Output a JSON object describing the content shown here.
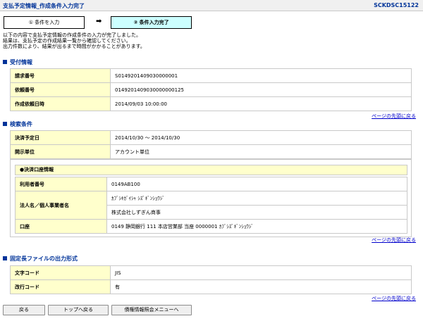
{
  "header": {
    "title": "支払予定情報_作成条件入力完了",
    "screen_id": "SCKDSC15122"
  },
  "steps": {
    "step1": "① 条件を入力",
    "arrow": "➡",
    "step2": "② 条件入力完了"
  },
  "intro": [
    "以下の内容で支払予定情報の作成条件の入力が完了しました。",
    "結果は、支払予定の作成結果一覧から確認してください。",
    "出力件数により、結果が出るまで時間がかかることがあります。"
  ],
  "reception": {
    "heading": "受付情報",
    "rows": [
      {
        "label": "請求番号",
        "value": "S0149201409030000001"
      },
      {
        "label": "依頼番号",
        "value": "0149201409030000000125"
      },
      {
        "label": "作成依頼日時",
        "value": "2014/09/03 10:00:00"
      }
    ]
  },
  "search": {
    "heading": "検索条件",
    "rows": [
      {
        "label": "決済予定日",
        "value": "2014/10/30 ～ 2014/10/30"
      },
      {
        "label": "開示単位",
        "value": "アカウント単位"
      }
    ],
    "account": {
      "heading": "●決済口座情報",
      "user_no_label": "利用者番号",
      "user_no": "0149AB100",
      "name_label": "法人名／個人事業者名",
      "name_kana": "ｶﾌﾞｼｷｶﾞｲｼｬ ｼｽﾞｷﾞﾝｼｮｳｼﾞ",
      "name_kanji": "株式会社しずぎん商事",
      "account_label": "口座",
      "account": "0149 静岡銀行 111 本店営業部 当座 0000001 ｶﾌﾞｼｽﾞｷﾞﾝｼｮｳｼﾞ"
    }
  },
  "file_format": {
    "heading": "固定長ファイルの出力形式",
    "rows": [
      {
        "label": "文字コード",
        "value": "JIS"
      },
      {
        "label": "改行コード",
        "value": "有"
      }
    ]
  },
  "pagetop_label": "ページの先頭に戻る",
  "buttons": {
    "back": "戻る",
    "top": "トップへ戻る",
    "menu": "債権情報照会メニューへ"
  }
}
